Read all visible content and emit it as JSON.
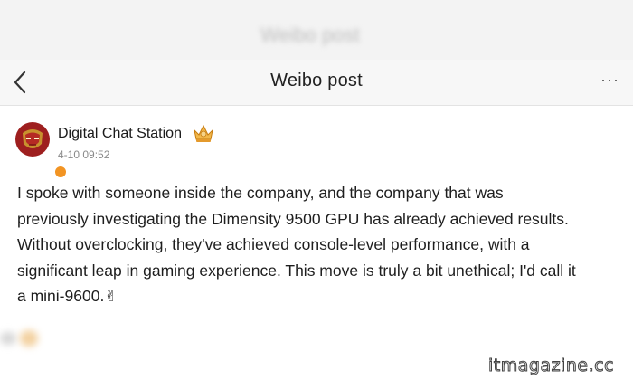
{
  "header_bg": {
    "title": "Weibo post"
  },
  "navbar": {
    "title": "Weibo post",
    "back_icon": "chevron-left-icon",
    "more_label": "···"
  },
  "post": {
    "author": "Digital Chat Station",
    "verified_badge_color": "#f29423",
    "crown_icon": "crown-icon",
    "timestamp": "4-10 09:52",
    "lines": [
      "I spoke with someone inside the company, and the company that was",
      "previously investigating the Dimensity 9500 GPU has already achieved results.",
      "Without overclocking, they've achieved console-level performance, with a",
      "significant leap in gaming experience. This move is truly a bit unethical; I'd call it",
      "a mini-9600.✌"
    ]
  },
  "watermark": "itmagazine.cc",
  "colors": {
    "navbar_bg": "#f7f7f7",
    "text": "#1e1e1e",
    "meta": "#8a8a8a"
  }
}
